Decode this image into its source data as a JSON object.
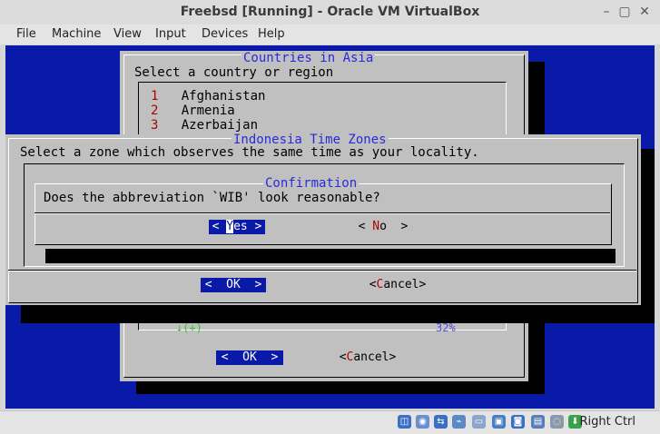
{
  "window": {
    "title": "Freebsd [Running] - Oracle VM VirtualBox",
    "buttons": [
      "–",
      "▢",
      "✕"
    ]
  },
  "menu": [
    "File",
    "Machine",
    "View",
    "Input",
    "Devices",
    "Help"
  ],
  "countries_dialog": {
    "title": "Countries in Asia",
    "prompt": "Select a country or region",
    "items": [
      {
        "num": "1",
        "label": "Afghanistan"
      },
      {
        "num": "2",
        "label": "Armenia"
      },
      {
        "num": "3",
        "label": "Azerbaijan"
      }
    ],
    "scroll_left": "↓(+)",
    "scroll_pct": "32%",
    "ok_label": "<  OK  >",
    "cancel_label": "<Cancel>"
  },
  "zones_dialog": {
    "title": "Indonesia Time Zones",
    "prompt": "Select a zone which observes the same time as your locality.",
    "ok_label": "<  OK  >",
    "cancel_label": "<Cancel>"
  },
  "confirm_dialog": {
    "title": "Confirmation",
    "question": "Does the abbreviation `WIB' look reasonable?",
    "yes_label": "< Yes >",
    "no_label": "<  No  >"
  },
  "status": {
    "host_key": "Right Ctrl",
    "icons": [
      "hdd-icon",
      "optical-icon",
      "network-icon",
      "usb-icon",
      "shared-folder-icon",
      "display-icon",
      "video-capture-icon",
      "cpu-icon",
      "mouse-icon",
      "arrow-icon"
    ]
  }
}
